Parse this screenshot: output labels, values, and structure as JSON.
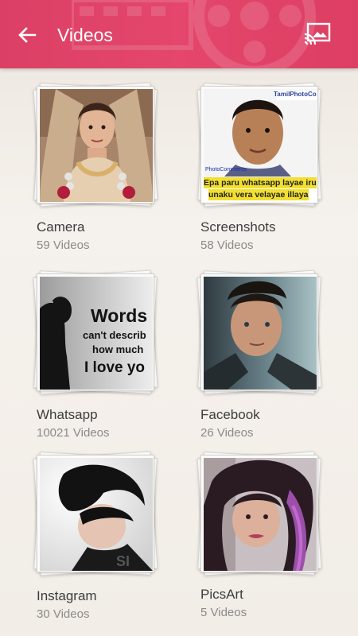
{
  "appbar": {
    "title": "Videos",
    "color": "#e1416a"
  },
  "albums": [
    {
      "name": "Camera",
      "count": "59 Videos",
      "thumb": "bride-portrait"
    },
    {
      "name": "Screenshots",
      "count": "58 Videos",
      "thumb": "man-meme",
      "meme_line1": "Epa paru whatsapp layae irukiy",
      "meme_line2": "unaku vera velayae illaya",
      "meme_badge": "TamilPhotoComments",
      "meme_watermark": "PhotoComments"
    },
    {
      "name": "Whatsapp",
      "count": "10021 Videos",
      "thumb": "words-quote",
      "quote_line1": "Words",
      "quote_line2": "can't describ",
      "quote_line3": "how much",
      "quote_line4": "I love yo"
    },
    {
      "name": "Facebook",
      "count": "26 Videos",
      "thumb": "man-portrait"
    },
    {
      "name": "Instagram",
      "count": "30 Videos",
      "thumb": "emo-boy"
    },
    {
      "name": "PicsArt",
      "count": "5 Videos",
      "thumb": "girl-selfie"
    }
  ]
}
